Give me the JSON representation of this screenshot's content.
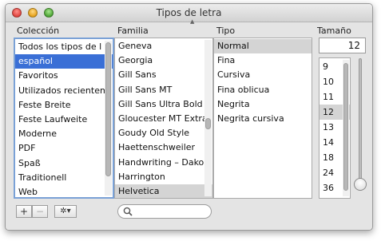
{
  "window": {
    "title": "Tipos de letra"
  },
  "headers": {
    "collection": "Colección",
    "family": "Familia",
    "typeface": "Tipo",
    "size": "Tamaño"
  },
  "collections": [
    "Todos los tipos de l",
    "español",
    "Favoritos",
    "Utilizados recientem",
    "Feste Breite",
    "Feste Laufweite",
    "Moderne",
    "PDF",
    "Spaß",
    "Traditionell",
    "Web"
  ],
  "collections_selected": "español",
  "families": [
    "Geneva",
    "Georgia",
    "Gill Sans",
    "Gill Sans MT",
    "Gill Sans Ultra Bold",
    "Gloucester MT Extra",
    "Goudy Old Style",
    "Haettenschweiler",
    "Handwriting – Dako",
    "Harrington",
    "Helvetica"
  ],
  "families_selected": "Helvetica",
  "typefaces": [
    "Normal",
    "Fina",
    "Cursiva",
    "Fina oblicua",
    "Negrita",
    "Negrita cursiva"
  ],
  "typefaces_selected": "Normal",
  "size": {
    "value": "12",
    "list": [
      "9",
      "10",
      "11",
      "12",
      "13",
      "14",
      "18",
      "24",
      "36"
    ],
    "selected": "12"
  },
  "bottom": {
    "add_label": "+",
    "remove_label": "−",
    "action_label": "✲▾",
    "search_value": ""
  },
  "colors": {
    "selection_blue": "#3a6fd6",
    "selection_gray": "#d4d4d4",
    "focus_ring": "#7aa1d6"
  },
  "icons": [
    "close-icon",
    "minimize-icon",
    "zoom-icon",
    "gear-icon",
    "search-icon"
  ]
}
